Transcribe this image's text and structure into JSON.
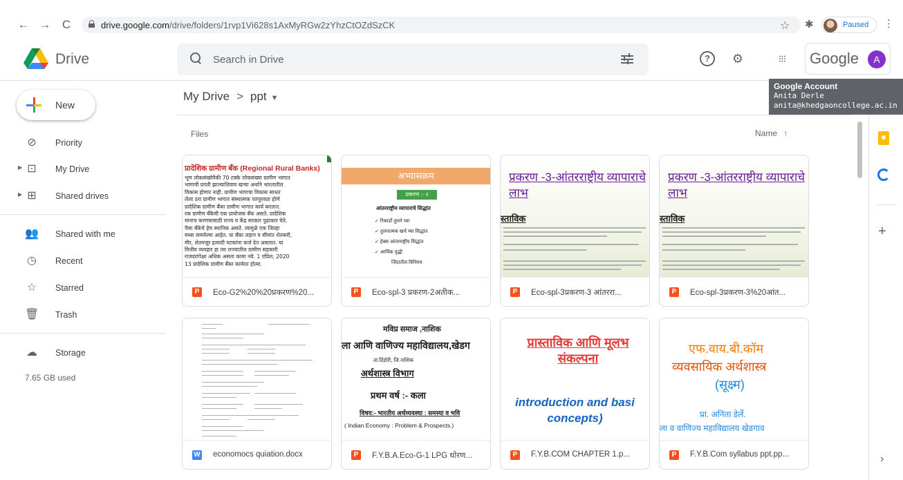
{
  "browser": {
    "url_host": "drive.google.com",
    "url_path": "/drive/folders/1rvp1Vi628s1AxMyRGw2zYhzCtOZdSzCK",
    "profile_status": "Paused"
  },
  "header": {
    "brand": "Drive",
    "search_placeholder": "Search in Drive",
    "account_wordmark": "Google",
    "avatar_letter": "A"
  },
  "tooltip": {
    "title": "Google Account",
    "name": "Anita Derle",
    "email": "anita@khedgaoncollege.ac.in"
  },
  "sidebar": {
    "new_label": "New",
    "items": [
      {
        "label": "Priority",
        "icon": "priority-icon"
      },
      {
        "label": "My Drive",
        "icon": "my-drive-icon"
      },
      {
        "label": "Shared drives",
        "icon": "shared-drives-icon"
      },
      {
        "label": "Shared with me",
        "icon": "shared-with-me-icon"
      },
      {
        "label": "Recent",
        "icon": "clock-icon"
      },
      {
        "label": "Starred",
        "icon": "star-icon"
      },
      {
        "label": "Trash",
        "icon": "trash-icon"
      },
      {
        "label": "Storage",
        "icon": "cloud-icon"
      }
    ],
    "storage_used": "7.65 GB used"
  },
  "main": {
    "breadcrumb_root": "My Drive",
    "breadcrumb_separator": ">",
    "breadcrumb_current": "ppt",
    "section_label": "Files",
    "sort_label": "Name",
    "files": [
      {
        "name": "Eco-G2%20%20प्रकरण%20...",
        "type": "P",
        "thumb": {
          "title": "प्रादेशिक ग्रामीण बँक (Regional Rural Banks)",
          "lines": [
            "भूण लोकसंख्येपैकी 70 टक्के लोकसंख्या ग्रामीण भागात",
            "भागाची प्रगती झाल्याशिवाय खऱ्या अर्थाने भारतातील",
            "विकास होणार नाही. ग्रामीण भागाचा विकास साधत",
            "लेला ठरा ग्रामीण भागात संस्थात्मक पतपुरवठा होणे",
            "प्रादेशिक ग्रामीण बँका ग्रामीण भागात कार्य करतात.",
            "रक ग्रामीण बँकेची एक प्रायोजक बँक असते. प्रादेशिक",
            "मानाच करणयासाठी राज्य व केंद्र सरकार पुढाकार घेते.",
            "पैसा बँकेचे हेच स्थानिक असते. त्यामुळे एक जिल्हा",
            "मध्या समलेल्या आहेत. या बँका लहान व सीमांत शेतकरी,",
            "मीर, शेतमजूर इत्यादी घटकांना कर्ज देत असतात. या",
            "वित्तीय व्यवहार हा त्या राज्यातील ग्रामीण सहकारी",
            "राजदरांपेक्षा अधिक असता कामा नये. 1 एप्रिल, 2020",
            "13 प्रादेशिक ग्रामीण बँका कार्यरत होत्या."
          ]
        }
      },
      {
        "name": "Eco-spl-3 प्रकरण-2अतीक...",
        "type": "P",
        "thumb": {
          "banner": "अभ्यासक्रम",
          "tag": "प्रकरण :- २",
          "subtitle": "आंतरराष्ट्रीय व्यापाराचे सिद्धांत",
          "items": [
            "✓ रिकार्डो तुलने च्या",
            "✓ तुलनात्मक खर्च च्या सिद्धांत",
            "✓ हेक्स आंतरराष्ट्रीय सिद्धांत",
            "✓ आर्थिक वृद्धी",
            "जिंदातील विनिमय"
          ]
        }
      },
      {
        "name": "Eco-spl-3प्रकरण-3 आंतररा...",
        "type": "P",
        "thumb": {
          "title": "प्रकरण -3-आंतरराष्ट्रीय व्यापाराचे लाभ",
          "subtitle": "स्ताविक"
        }
      },
      {
        "name": "Eco-spl-3प्रकरण-3%20आंत...",
        "type": "P",
        "thumb": {
          "title": "प्रकरण -3-आंतरराष्ट्रीय व्यापाराचे लाभ",
          "subtitle": "स्ताविक"
        }
      },
      {
        "name": "economocs quiation.docx",
        "type": "W",
        "thumb": {}
      },
      {
        "name": "F.Y.B.A.Eco-G-1 LPG धोरण...",
        "type": "P",
        "thumb": {
          "l1": "मविप्र समाज ,नाशिक",
          "l2": "ला आणि वाणिज्य महाविद्यालय,खेडग",
          "l3": "ता.दिंडोरी, जि.नाशिक",
          "l4": "अर्थशास्त्र विभाग",
          "l5": "प्रथम वर्ष :- कला",
          "l6": "विषय:- भारतीय अर्थव्यवस्था : समस्या व भवि",
          "l7": "( Indian Economy : Problem & Prospects.)"
        }
      },
      {
        "name": "F.Y.B.COM CHAPTER 1.p...",
        "type": "P",
        "thumb": {
          "title": "प्रास्ताविक आणि मूलभ संकल्पना",
          "subtitle": "introduction and basi concepts)"
        }
      },
      {
        "name": "F.Y.B.Com syllabus ppt.pp...",
        "type": "P",
        "thumb": {
          "l1": "एफ.वाय.बी.कॉम",
          "l2": "व्यवसायिक अर्थशास्त्र",
          "l3": "(सूक्ष्म)",
          "l4": "प्रा. अनिता  डेर्ले.",
          "l5": "ला व वाणिज्य महाविद्यालय खेडगाव"
        }
      }
    ]
  },
  "colors": {
    "brand_red": "#ea4335",
    "brand_green": "#34a853",
    "brand_blue": "#4285f4",
    "brand_yellow": "#fbbc04",
    "avatar_purple": "#8430ce",
    "ppt_orange": "#f4511e"
  }
}
